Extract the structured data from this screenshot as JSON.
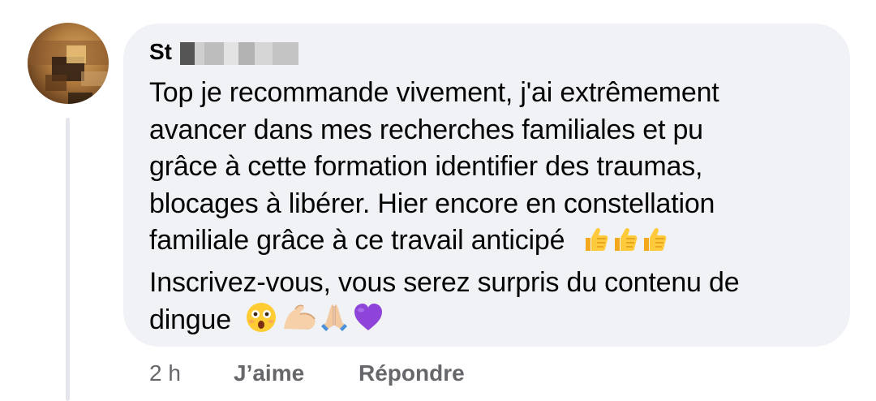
{
  "comment": {
    "author": "St",
    "lines": [
      "Top je recommande vivement, j'ai extrêmement",
      "avancer dans mes recherches familiales et pu",
      "grâce à cette formation identifier des traumas,",
      "blocages à libérer. Hier encore en constellation",
      "familiale grâce à ce travail anticipé",
      "Inscrivez-vous, vous serez surpris du contenu de",
      "dingue"
    ],
    "line5_emojis": [
      "thumbs-up-icon",
      "thumbs-up-icon",
      "thumbs-up-icon"
    ],
    "line7_emojis": [
      "astonished-face-icon",
      "flexed-biceps-icon",
      "folded-hands-icon",
      "purple-heart-icon"
    ]
  },
  "actions": {
    "time": "2 h",
    "like": "J’aime",
    "reply": "Répondre"
  },
  "colors": {
    "bubble": "#f0f2f5",
    "text": "#050505",
    "meta": "#65676b",
    "thread_line": "#e4e6eb"
  }
}
